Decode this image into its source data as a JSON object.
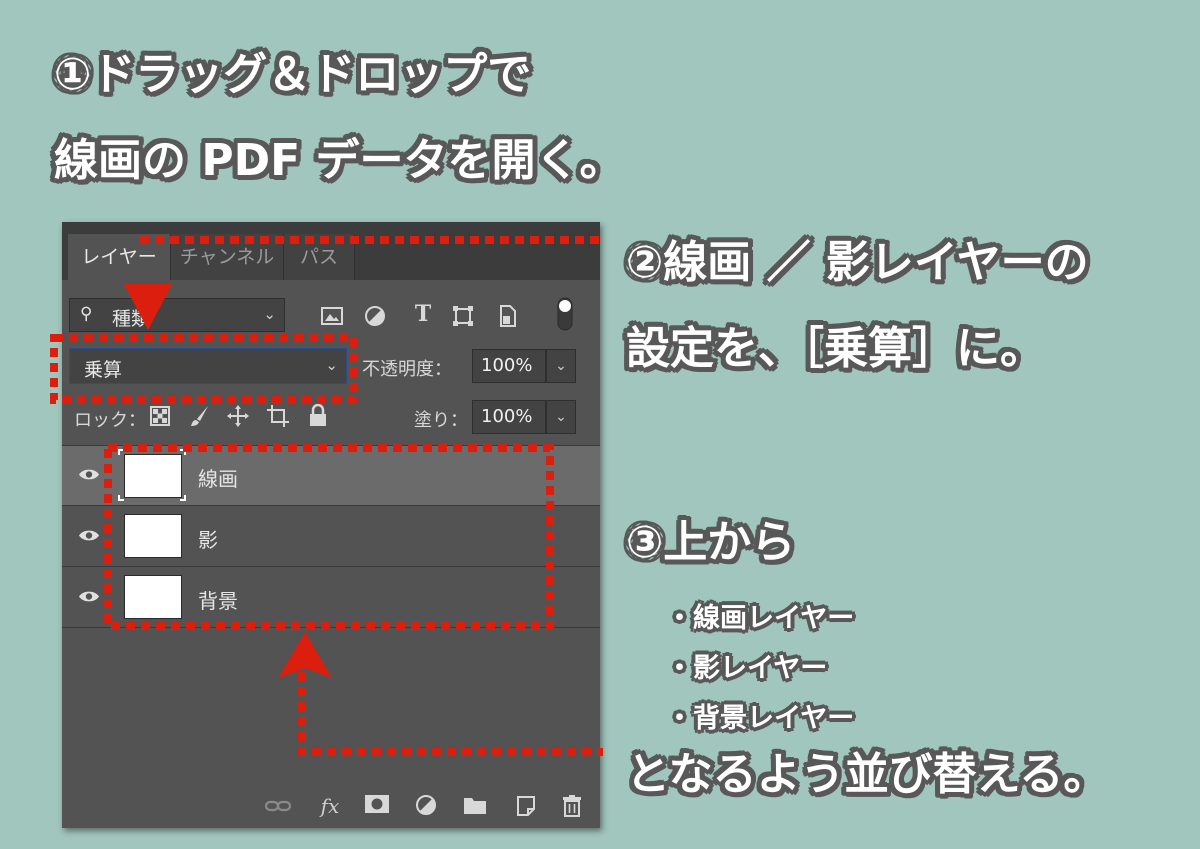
{
  "instructions": {
    "step1_line1": "①ドラッグ＆ドロップで",
    "step1_line2": "線画の PDF データを開く。",
    "step2_line1": "②線画 ／ 影レイヤーの",
    "step2_line2": "設定を、［乗算］に。",
    "step3_line1": "③上から",
    "step3_item1": "・線画レイヤー",
    "step3_item2": "・影レイヤー",
    "step3_item3": "・背景レイヤー",
    "step3_line_last": "となるよう並び替える。"
  },
  "panel": {
    "tabs": [
      "レイヤー",
      "チャンネル",
      "パス"
    ],
    "filter_label": "種類",
    "blend_mode": "乗算",
    "opacity_label": "不透明度：",
    "opacity_value": "100%",
    "lock_label": "ロック：",
    "fill_label": "塗り：",
    "fill_value": "100%",
    "layers": [
      {
        "name": "線画",
        "selected": true
      },
      {
        "name": "影",
        "selected": false
      },
      {
        "name": "背景",
        "selected": false
      }
    ]
  },
  "colors": {
    "background": "#a1c6bd",
    "highlight": "#dc1e0f",
    "panel": "#535353"
  }
}
